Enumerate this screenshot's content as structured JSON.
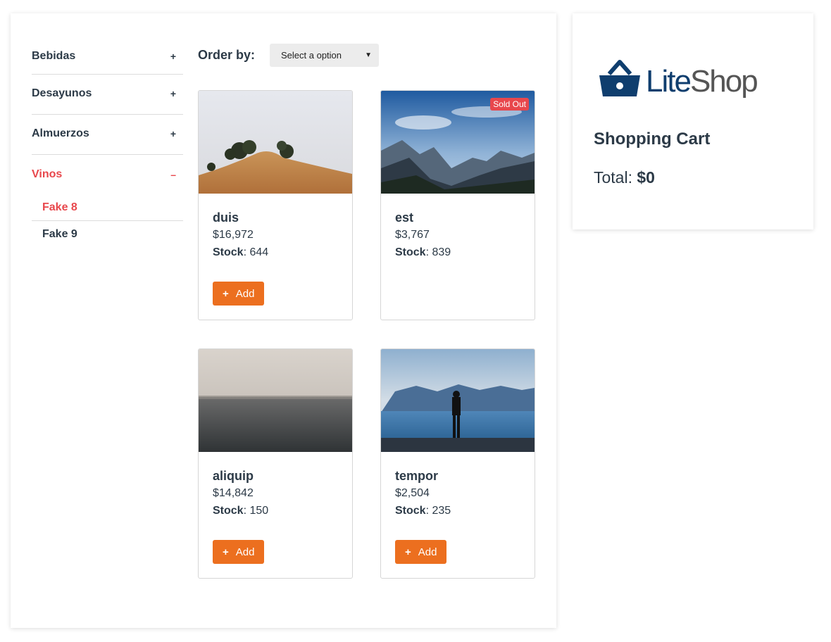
{
  "sidebar": {
    "categories": [
      {
        "label": "Bebidas",
        "toggle": "+"
      },
      {
        "label": "Desayunos",
        "toggle": "+"
      },
      {
        "label": "Almuerzos",
        "toggle": "+"
      },
      {
        "label": "Vinos",
        "toggle": "–"
      }
    ],
    "subcategories": [
      {
        "label": "Fake 8"
      },
      {
        "label": "Fake 9"
      }
    ]
  },
  "orderby": {
    "label": "Order by:",
    "selected": "Select a option",
    "caret": "▼"
  },
  "products": [
    {
      "name": "duis",
      "price": "$16,972",
      "stock_label": "Stock",
      "stock": ": 644",
      "add_label": "Add",
      "plus": "+"
    },
    {
      "name": "est",
      "price": "$3,767",
      "stock_label": "Stock",
      "stock": ": 839",
      "badge": "Sold Out"
    },
    {
      "name": "aliquip",
      "price": "$14,842",
      "stock_label": "Stock",
      "stock": ": 150",
      "add_label": "Add",
      "plus": "+"
    },
    {
      "name": "tempor",
      "price": "$2,504",
      "stock_label": "Stock",
      "stock": ": 235",
      "add_label": "Add",
      "plus": "+"
    }
  ],
  "cart": {
    "logo_lite": "Lite",
    "logo_shop": "Shop",
    "title": "Shopping Cart",
    "total_label": "Total: ",
    "total_value": "$0"
  },
  "colors": {
    "accent": "#e8474c",
    "button": "#ec6f1f",
    "text": "#2c3a47",
    "logo_blue": "#0f3e6e"
  }
}
